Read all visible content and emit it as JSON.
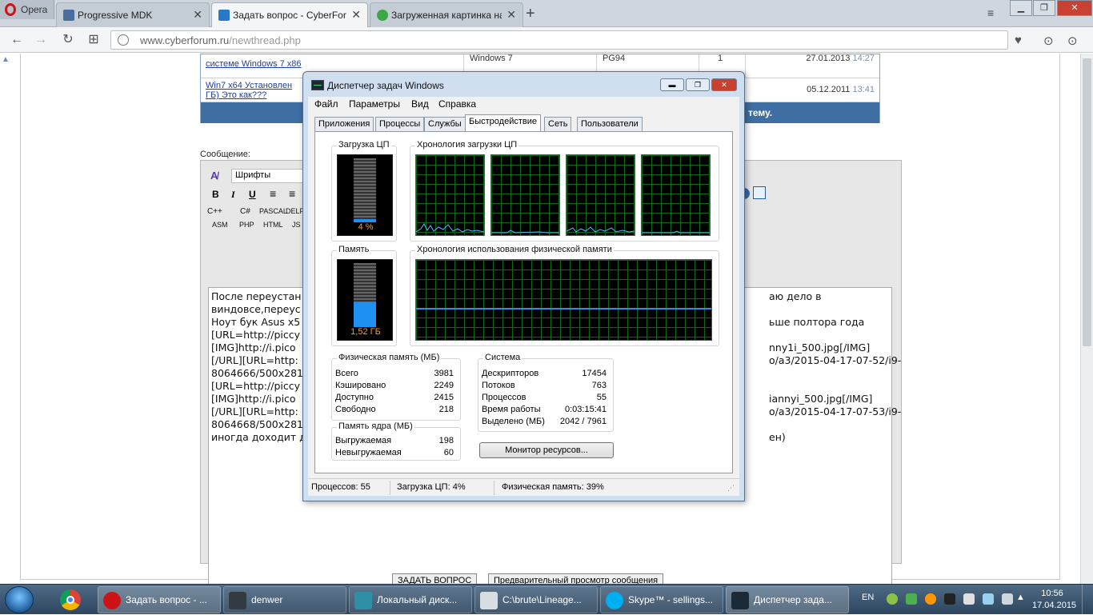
{
  "browser": {
    "app_label": "Opera",
    "tabs": [
      {
        "title": "Progressive MDK",
        "color": "#4a6e9d"
      },
      {
        "title": "Задать вопрос - CyberForum",
        "color": "#2a78c8"
      },
      {
        "title": "Загруженная картинка на",
        "color": "#3aa845"
      }
    ],
    "url_host": "www.cyberforum.ru",
    "url_path": "/newthread.php"
  },
  "similar_threads": [
    {
      "title": "системе Windows 7 x86",
      "os": "Windows 7",
      "author": "PG94",
      "replies": "1",
      "date": "27.01.2013",
      "time": "14:27"
    },
    {
      "title_line1": "Win7 x64 Установлен",
      "title_line2": "ГБ) Это как???",
      "date": "05.12.2011",
      "time": "13:41"
    }
  ],
  "similar_footer": "тему.",
  "message_label": "Сообщение:",
  "editor_toolbar": {
    "font_select": "Шрифты",
    "bold": "B",
    "italic": "I",
    "underline": "U",
    "lang_row1": [
      "C++",
      "C#",
      "PASCAL",
      "DELPH"
    ],
    "lang_row2": [
      "ASM",
      "PHP",
      "HTML",
      "JS"
    ]
  },
  "editor_lines": [
    {
      "left": "После переустан",
      "right": "аю дело в"
    },
    {
      "left": "виндовсе,переус",
      "right": ""
    },
    {
      "left": "Ноут бук Asus x5",
      "right": "ьше полтора года"
    },
    {
      "left": "[URL=http://piccy",
      "right": ""
    },
    {
      "left": "[IMG]http://i.pico",
      "right": "nny1i_500.jpg[/IMG]"
    },
    {
      "left": "[/URL][URL=http:",
      "right": "o/a3/2015-04-17-07-52/i9-"
    },
    {
      "left": "8064666/500x281",
      "right": ""
    },
    {
      "left": "[URL=http://piccy",
      "right": ""
    },
    {
      "left": "[IMG]http://i.pico",
      "right": "iannyi_500.jpg[/IMG]"
    },
    {
      "left": "[/URL][URL=http:",
      "right": "o/a3/2015-04-17-07-53/i9-"
    },
    {
      "left": "8064668/500x281",
      "right": ""
    },
    {
      "left": "иногда доходит д",
      "right": "ен)"
    }
  ],
  "page_buttons": [
    "ЗАДАТЬ ВОПРОС",
    "Предварительный просмотр сообщения"
  ],
  "taskmgr": {
    "title": "Диспетчер задач Windows",
    "menu": [
      "Файл",
      "Параметры",
      "Вид",
      "Справка"
    ],
    "tabs": [
      "Приложения",
      "Процессы",
      "Службы",
      "Быстродействие",
      "Сеть",
      "Пользователи"
    ],
    "active_tab": "Быстродействие",
    "cpu_usage_label": "Загрузка ЦП",
    "cpu_usage_value": "4 %",
    "cpu_fraction": 0.04,
    "cpu_history_label": "Хронология загрузки ЦП",
    "memory_label": "Память",
    "memory_value": "1,52 ГБ",
    "memory_fraction": 0.39,
    "mem_history_label": "Хронология использования физической памяти",
    "physical_memory": {
      "title": "Физическая память (МБ)",
      "rows": [
        {
          "k": "Всего",
          "v": "3981"
        },
        {
          "k": "Кэшировано",
          "v": "2249"
        },
        {
          "k": "Доступно",
          "v": "2415"
        },
        {
          "k": "Свободно",
          "v": "218"
        }
      ]
    },
    "kernel_memory": {
      "title": "Память ядра (МБ)",
      "rows": [
        {
          "k": "Выгружаемая",
          "v": "198"
        },
        {
          "k": "Невыгружаемая",
          "v": "60"
        }
      ]
    },
    "system": {
      "title": "Система",
      "rows": [
        {
          "k": "Дескрипторов",
          "v": "17454"
        },
        {
          "k": "Потоков",
          "v": "763"
        },
        {
          "k": "Процессов",
          "v": "55"
        },
        {
          "k": "Время работы",
          "v": "0:03:15:41"
        },
        {
          "k": "Выделено (МБ)",
          "v": "2042 / 7961"
        }
      ]
    },
    "resource_monitor_button": "Монитор ресурсов...",
    "status": [
      "Процессов: 55",
      "Загрузка ЦП: 4%",
      "Физическая память: 39%"
    ]
  },
  "taskbar": {
    "items": [
      {
        "label": "Задать вопрос - ...",
        "color": "#cc1417"
      },
      {
        "label": "denwer",
        "color": "#333a40"
      },
      {
        "label": "Локальный диск...",
        "color": "#2f8fa6"
      },
      {
        "label": "C:\\brute\\Lineage...",
        "color": "#d8dde2"
      },
      {
        "label": "Skype™ - sellings...",
        "color": "#00aff0"
      },
      {
        "label": "Диспетчер зада...",
        "color": "#1b2a36"
      }
    ],
    "lang": "EN",
    "time": "10:56",
    "date": "17.04.2015"
  }
}
